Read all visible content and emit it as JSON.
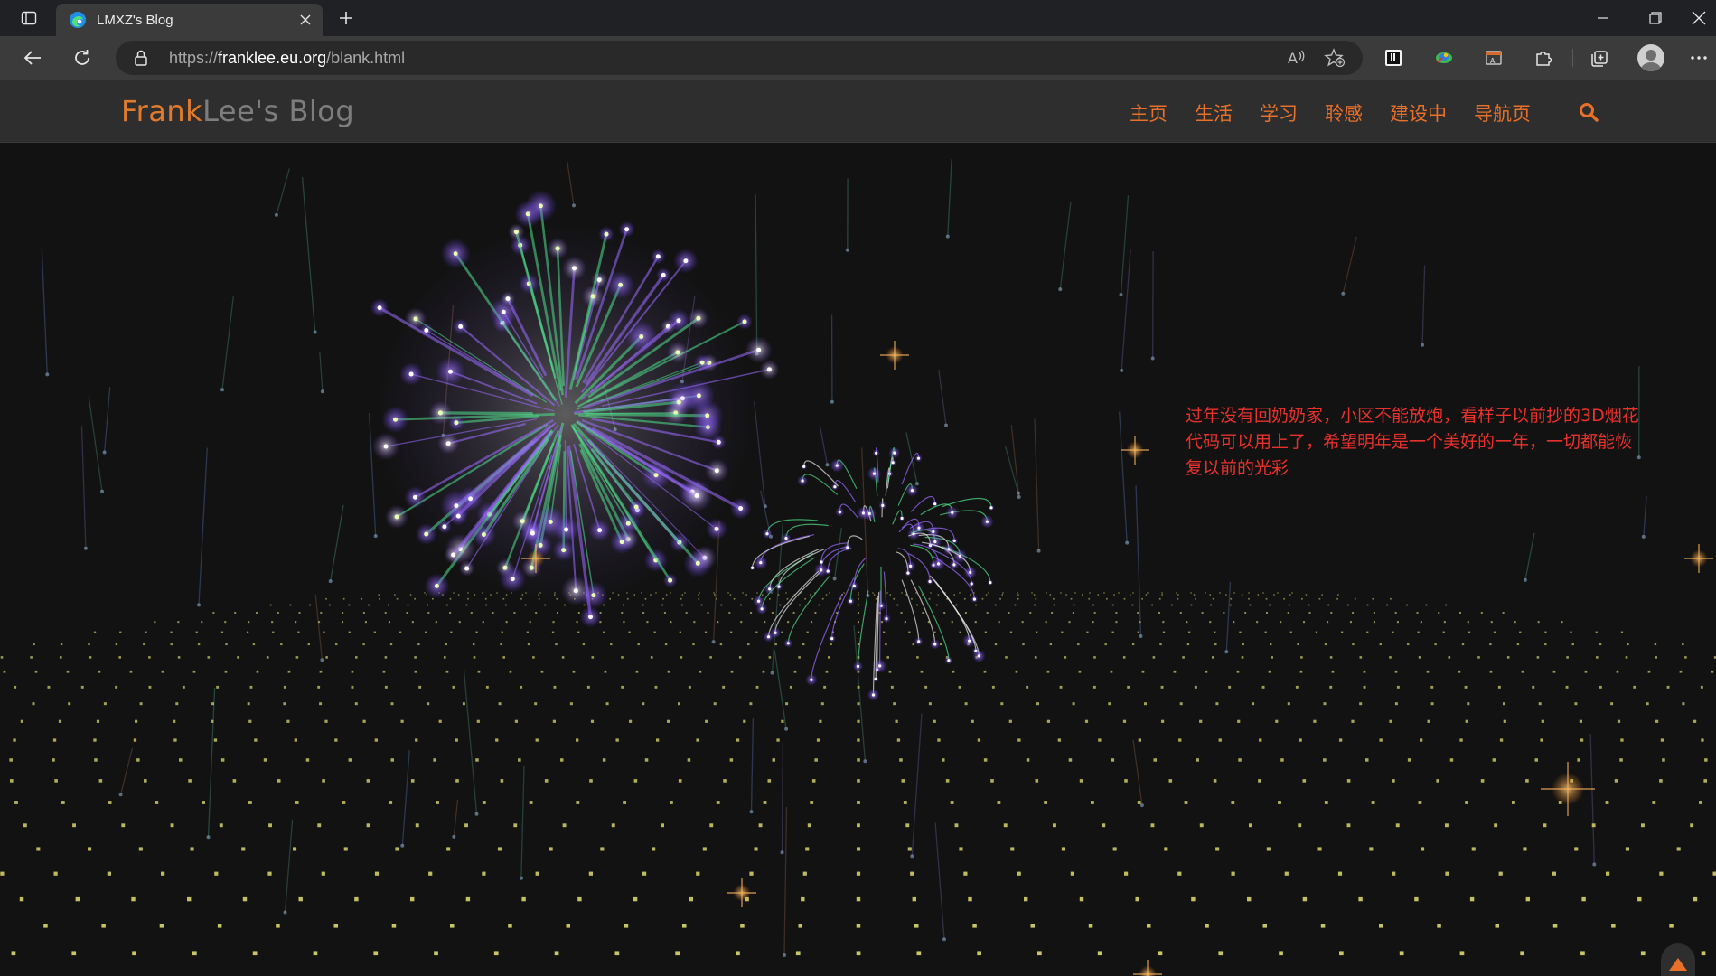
{
  "browser": {
    "tab": {
      "title": "LMXZ's Blog"
    },
    "url": {
      "scheme": "https://",
      "host": "franklee.eu.org",
      "path": "/blank.html"
    }
  },
  "site": {
    "brand": {
      "part1": "Frank",
      "part2": "Lee's Blog"
    },
    "nav": {
      "items": [
        "主页",
        "生活",
        "学习",
        "聆感",
        "建设中",
        "导航页"
      ]
    },
    "message": "过年没有回奶奶家，小区不能放炮，看样子以前抄的3D烟花代码可以用上了，希望明年是一个美好的一年，一切都能恢复以前的光彩"
  },
  "colors": {
    "brand_accent": "#e07b2d",
    "nav_text": "#e8702a",
    "message_text": "#e8312c",
    "scroll_arrow": "#e8702a",
    "firework_purple": "#9b6bff",
    "firework_green": "#4fe08a",
    "dot_grid": "#d8d36a"
  },
  "icons": {
    "tab_actions": "tab-actions-icon",
    "favicon": "edge-favicon-icon",
    "close": "close-icon",
    "new_tab": "plus-icon",
    "back": "back-arrow-icon",
    "refresh": "refresh-icon",
    "lock": "lock-icon",
    "read_aloud": "read-aloud-icon",
    "favorite": "add-favorite-icon",
    "extensions": "puzzle-icon",
    "collections": "collections-icon",
    "more": "more-icon",
    "search": "search-icon",
    "scroll_up": "caret-up-icon",
    "scroll_down": "caret-down-icon"
  }
}
